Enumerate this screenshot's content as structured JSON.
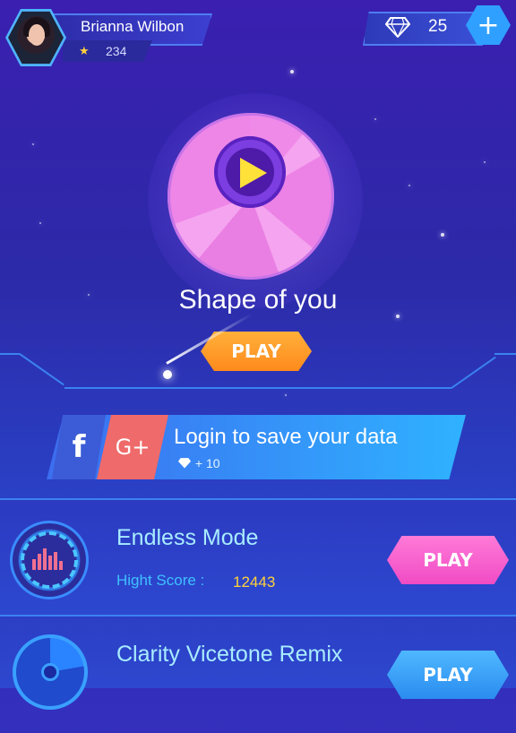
{
  "profile": {
    "name": "Brianna Wilbon",
    "score": "234"
  },
  "gems": {
    "count": "25",
    "add_label": "+"
  },
  "featured": {
    "song_title": "Shape of you",
    "play_label": "PLAY"
  },
  "login": {
    "facebook_label": "f",
    "google_label": "G+",
    "text": "Login to save your data",
    "reward": "+ 10"
  },
  "modes": [
    {
      "title": "Endless Mode",
      "high_score_label": "Hight Score :",
      "high_score": "12443",
      "play_label": "PLAY"
    },
    {
      "title": "Clarity Vicetone Remix",
      "play_label": "PLAY"
    }
  ],
  "colors": {
    "accent_pink": "#f04cc4",
    "accent_orange": "#ff8a1c",
    "accent_blue": "#2a8cf0",
    "highlight_yellow": "#ffd23a"
  }
}
